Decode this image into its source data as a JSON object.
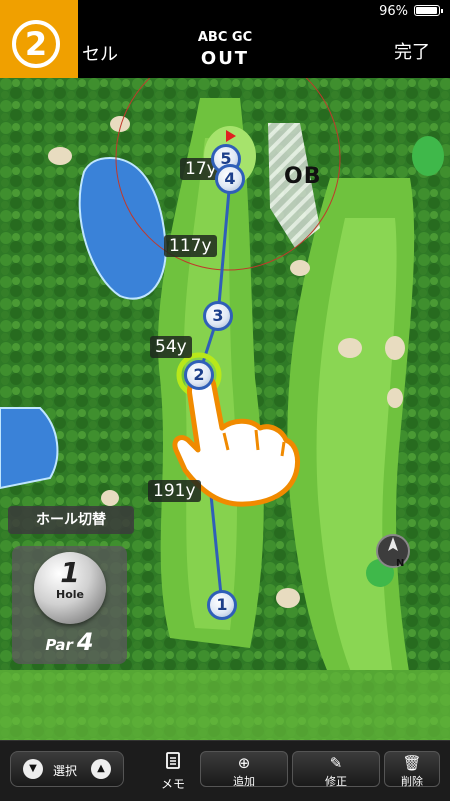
{
  "status": {
    "battery": "96%"
  },
  "header": {
    "step_number": "2",
    "cancel_label": "セル",
    "course_name": "ABC GC",
    "hole_label": "OUT",
    "done_label": "完了"
  },
  "map": {
    "ob_label": "OB",
    "distances": [
      "17y",
      "117y",
      "54y",
      "191y"
    ],
    "markers": [
      "5",
      "4",
      "3",
      "2",
      "1"
    ],
    "compass_label": "N"
  },
  "hole_panel": {
    "switch_label": "ホール切替",
    "hole_number": "1",
    "hole_word": "Hole",
    "par_label": "Par",
    "par_value": "4"
  },
  "toolbar": {
    "select_label": "選択",
    "memo_label": "メモ",
    "add_label": "追加",
    "edit_label": "修正",
    "delete_label": "削除"
  },
  "colors": {
    "accent": "#f0a000",
    "route_line": "#2f5fb8",
    "selected_ring": "#b8e81a"
  }
}
